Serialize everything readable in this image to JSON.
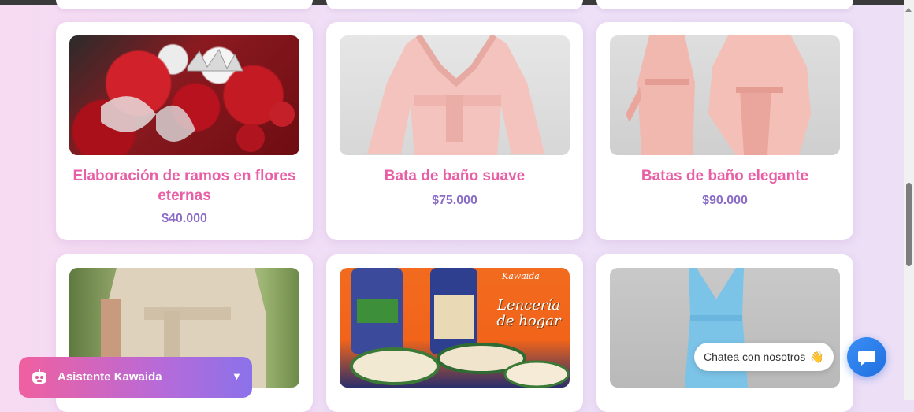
{
  "products": [
    {
      "title": "Elaboración de ramos en flores eternas",
      "price": "$40.000",
      "image": "red-eternal-roses-bouquet"
    },
    {
      "title": "Bata de baño suave",
      "price": "$75.000",
      "image": "pink-soft-bathrobe"
    },
    {
      "title": "Batas de baño elegante",
      "price": "$90.000",
      "image": "pink-elegant-bathrobes"
    },
    {
      "title": "",
      "price": "",
      "image": "person-in-beige-robe"
    },
    {
      "title": "",
      "price": "",
      "image": "lenceria-de-hogar-banner",
      "banner_brand": "Kawaida",
      "banner_text": "Lencería de hogar"
    },
    {
      "title": "",
      "price": "",
      "image": "light-blue-dress"
    }
  ],
  "chat": {
    "bubble_text": "Chatea con nosotros",
    "bubble_emoji": "👋",
    "button_icon": "chat-icon"
  },
  "assistant": {
    "label": "Asistente Kawaida",
    "icon": "robot-icon",
    "toggle_icon": "triangle-down-icon",
    "toggle_glyph": "▼"
  },
  "colors": {
    "title": "#e85fa6",
    "price": "#8a6cc7",
    "chat_button": "#2a7ff0",
    "assistant_from": "#f0609f",
    "assistant_to": "#8b72ea"
  }
}
